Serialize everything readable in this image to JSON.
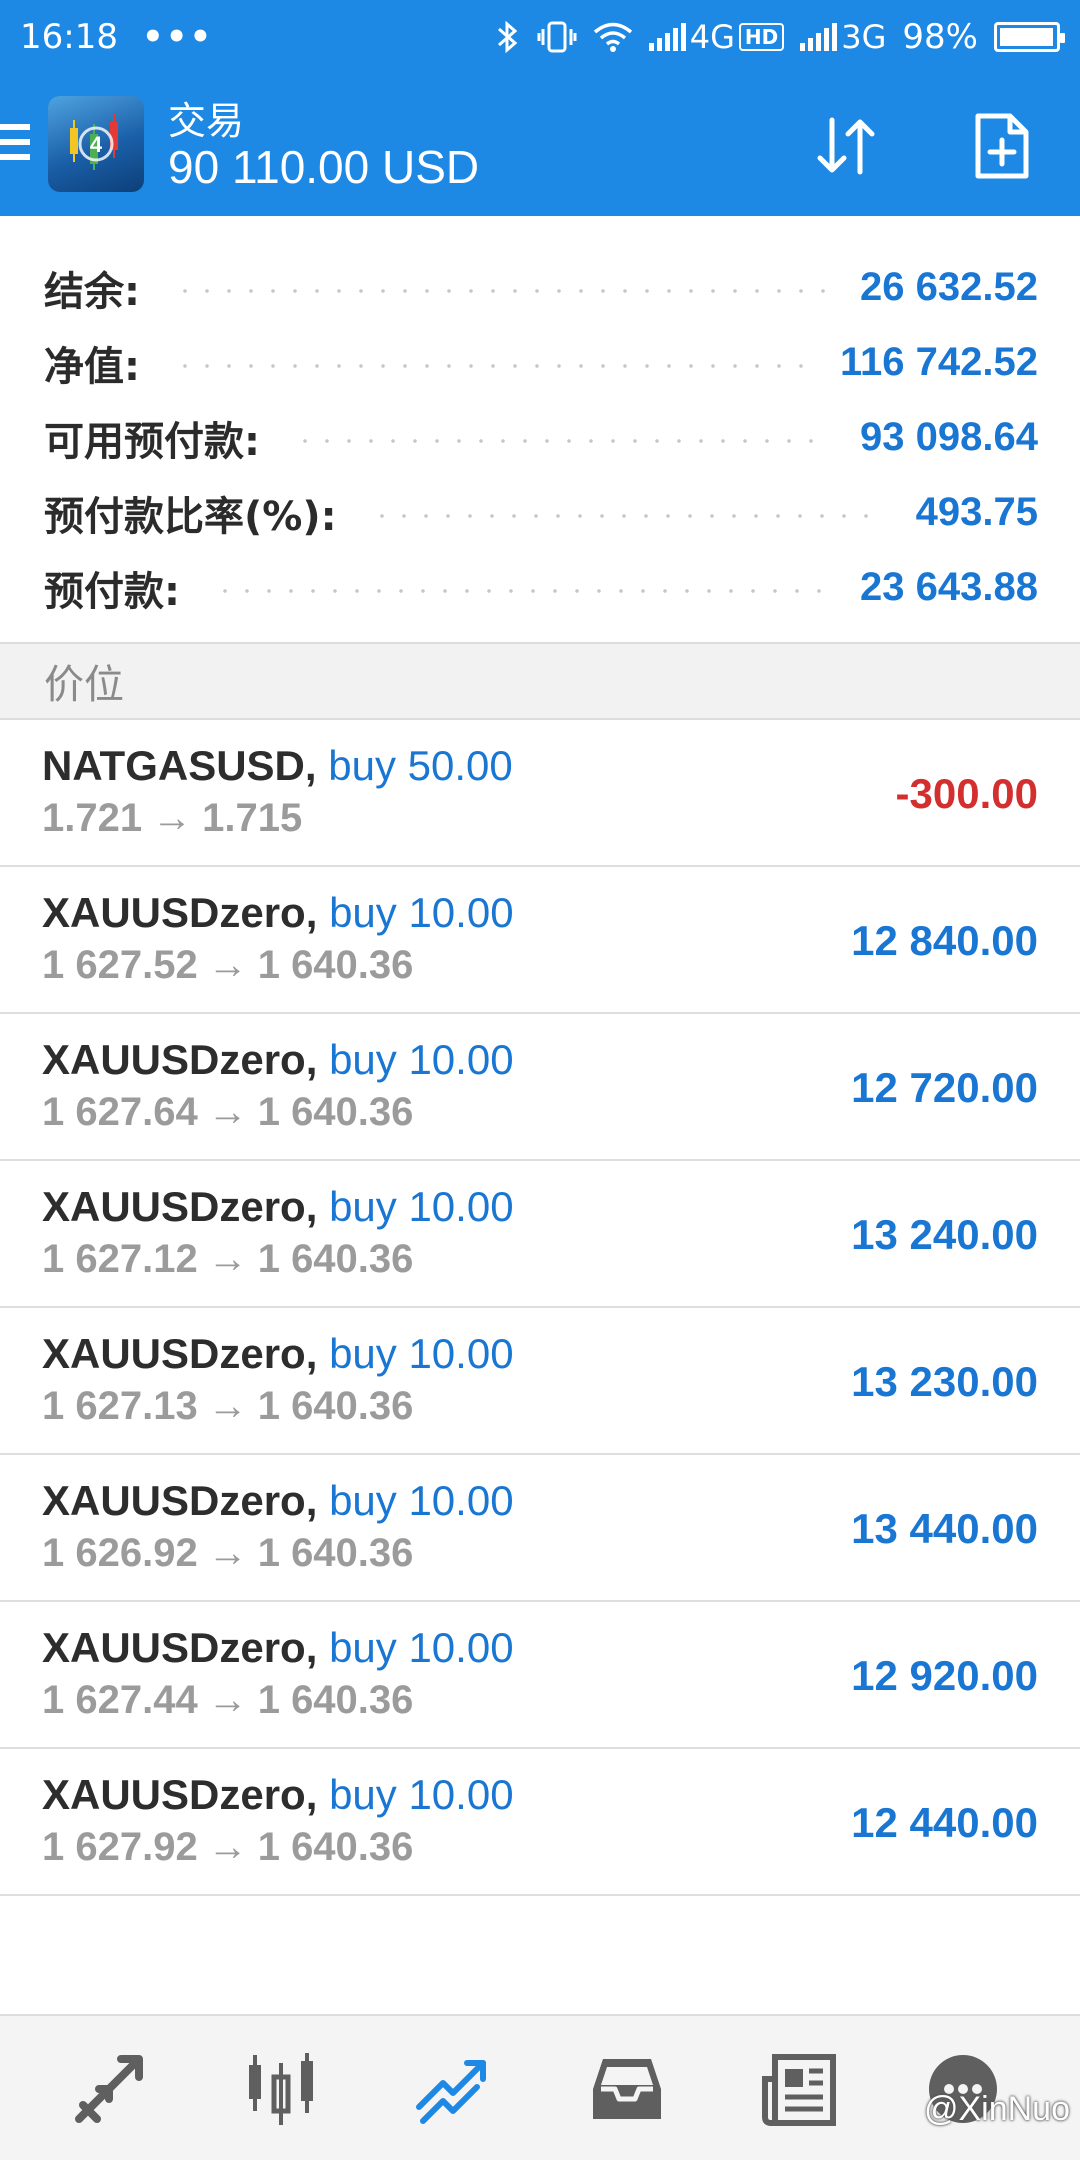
{
  "status_bar": {
    "time": "16:18",
    "more": "•••",
    "network_1": "4G",
    "hd": "HD",
    "network_2": "3G",
    "battery": "98%",
    "battery_level": 0.98
  },
  "app_bar": {
    "title": "交易",
    "balance": "90 110.00 USD"
  },
  "summary": [
    {
      "label": "结余:",
      "value": "26 632.52"
    },
    {
      "label": "净值:",
      "value": "116 742.52"
    },
    {
      "label": "可用预付款:",
      "value": "93 098.64"
    },
    {
      "label": "预付款比率(%):",
      "value": "493.75"
    },
    {
      "label": "预付款:",
      "value": "23 643.88"
    }
  ],
  "section": {
    "title": "价位"
  },
  "positions": [
    {
      "symbol": "NATGASUSD,",
      "type": "buy 50.00",
      "open": "1.721",
      "arrow": "→",
      "current": "1.715",
      "profit": "-300.00"
    },
    {
      "symbol": "XAUUSDzero,",
      "type": "buy 10.00",
      "open": "1 627.52",
      "arrow": "→",
      "current": "1 640.36",
      "profit": "12 840.00"
    },
    {
      "symbol": "XAUUSDzero,",
      "type": "buy 10.00",
      "open": "1 627.64",
      "arrow": "→",
      "current": "1 640.36",
      "profit": "12 720.00"
    },
    {
      "symbol": "XAUUSDzero,",
      "type": "buy 10.00",
      "open": "1 627.12",
      "arrow": "→",
      "current": "1 640.36",
      "profit": "13 240.00"
    },
    {
      "symbol": "XAUUSDzero,",
      "type": "buy 10.00",
      "open": "1 627.13",
      "arrow": "→",
      "current": "1 640.36",
      "profit": "13 230.00"
    },
    {
      "symbol": "XAUUSDzero,",
      "type": "buy 10.00",
      "open": "1 626.92",
      "arrow": "→",
      "current": "1 640.36",
      "profit": "13 440.00"
    },
    {
      "symbol": "XAUUSDzero,",
      "type": "buy 10.00",
      "open": "1 627.44",
      "arrow": "→",
      "current": "1 640.36",
      "profit": "12 920.00"
    },
    {
      "symbol": "XAUUSDzero,",
      "type": "buy 10.00",
      "open": "1 627.92",
      "arrow": "→",
      "current": "1 640.36",
      "profit": "12 440.00"
    }
  ],
  "bottom_nav": [
    {
      "icon": "quotes-arrows-icon",
      "active": false
    },
    {
      "icon": "chart-candles-icon",
      "active": false
    },
    {
      "icon": "trade-icon",
      "active": true
    },
    {
      "icon": "history-inbox-icon",
      "active": false
    },
    {
      "icon": "news-icon",
      "active": false
    },
    {
      "icon": "messages-icon",
      "active": false
    }
  ],
  "watermark": "@XinNuo",
  "colors": {
    "primary": "#1e88e5",
    "value_blue": "#1976d2",
    "loss_red": "#d32f2f",
    "muted_gray": "#9b9b9b",
    "nav_icon": "#5f5f5f"
  }
}
